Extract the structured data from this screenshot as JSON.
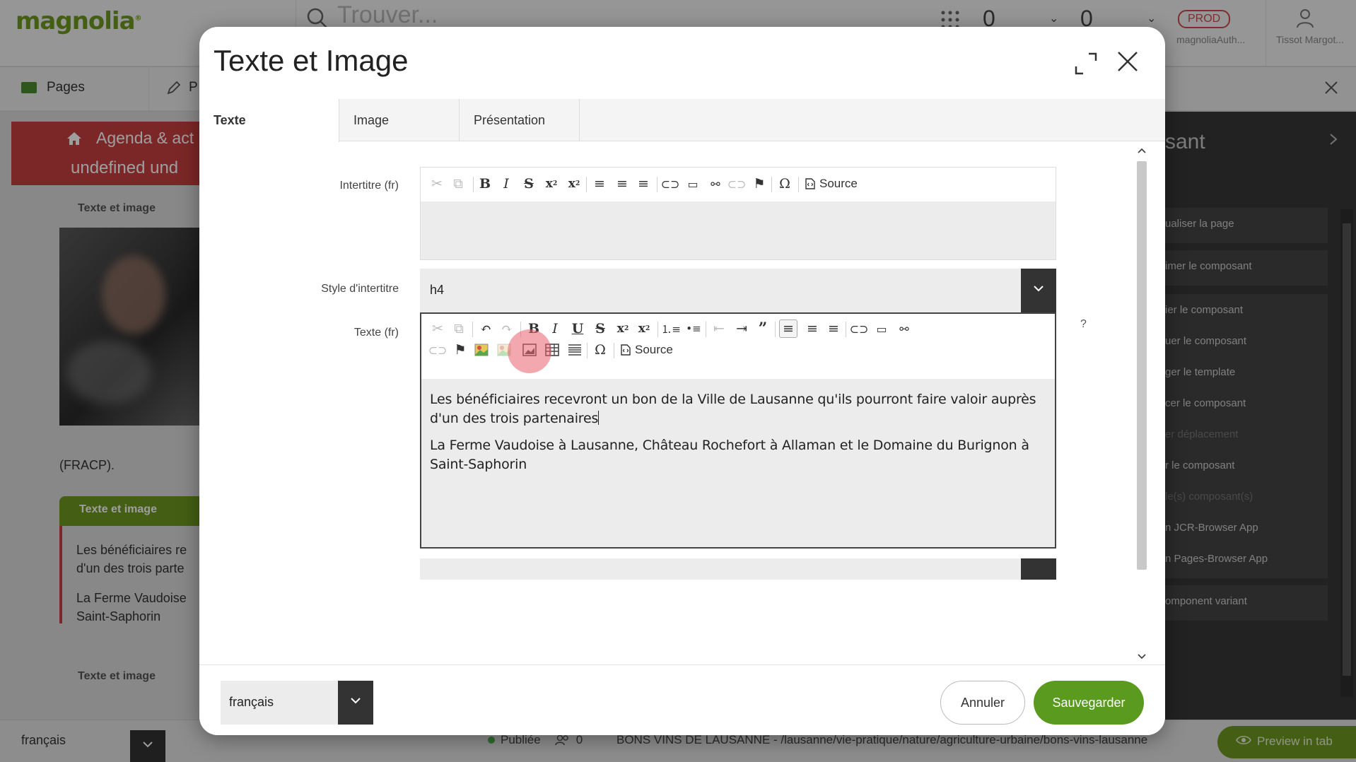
{
  "app": {
    "logo": "magnolia",
    "search_placeholder": "Trouver...",
    "counter1": "0",
    "counter2": "0",
    "env_badge": "PROD",
    "env_user": "magnoliaAuth...",
    "user_name": "Tissot Margot..."
  },
  "nav": {
    "pages_label": "Pages",
    "edit_label": "P"
  },
  "background_page": {
    "header_line1": "Agenda & act",
    "header_line2": "undefined    und",
    "component_label": "Texte et image",
    "fracp": "(FRACP).",
    "bg_para1_l1": "Les bénéficiaires re",
    "bg_para1_l2": "d'un des trois parte",
    "bg_para2_l1": "La Ferme Vaudoise",
    "bg_para2_l2": "Saint-Saphorin"
  },
  "right_panel": {
    "title": "sant",
    "items": [
      {
        "label": "ualiser la page",
        "dim": false
      },
      {
        "label": "imer le composant",
        "dim": false
      },
      {
        "label": "ier le composant",
        "dim": false
      },
      {
        "label": "uer le composant",
        "dim": false
      },
      {
        "label": "ger le template",
        "dim": false
      },
      {
        "label": "cer le composant",
        "dim": false
      },
      {
        "label": "er déplacement",
        "dim": true
      },
      {
        "label": "r le composant",
        "dim": false
      },
      {
        "label": "le(s) composant(s)",
        "dim": true
      },
      {
        "label": "n JCR-Browser App",
        "dim": false
      },
      {
        "label": "n Pages-Browser App",
        "dim": false
      },
      {
        "label": "omponent variant",
        "dim": false
      }
    ]
  },
  "statusbar": {
    "language": "français",
    "published": "Publiée",
    "count": "0",
    "path": "BONS VINS DE LAUSANNE - /lausanne/vie-pratique/nature/agriculture-urbaine/bons-vins-lausanne",
    "preview_label": "Preview in tab"
  },
  "dialog": {
    "title": "Texte et Image",
    "tabs": [
      {
        "label": "Texte",
        "active": true
      },
      {
        "label": "Image",
        "active": false
      },
      {
        "label": "Présentation",
        "active": false
      }
    ],
    "fields": {
      "intertitre_label": "Intertitre (fr)",
      "style_label": "Style d'intertitre",
      "style_value": "h4",
      "texte_label": "Texte (fr)",
      "help": "?",
      "source_label": "Source"
    },
    "texte_content": {
      "para1": "Les bénéficiaires recevront un bon de la Ville de Lausanne qu'ils pourront faire valoir auprès d'un des trois partenaires",
      "para2": "La Ferme Vaudoise à Lausanne, Château Rochefort à Allaman et le Domaine du Burignon à Saint-Saphorin"
    },
    "footer": {
      "language": "français",
      "cancel": "Annuler",
      "save": "Sauvegarder"
    }
  },
  "colors": {
    "accent_green": "#5a9a1e",
    "brand_red": "#c83f3f",
    "click_marker": "#e95f6e"
  }
}
